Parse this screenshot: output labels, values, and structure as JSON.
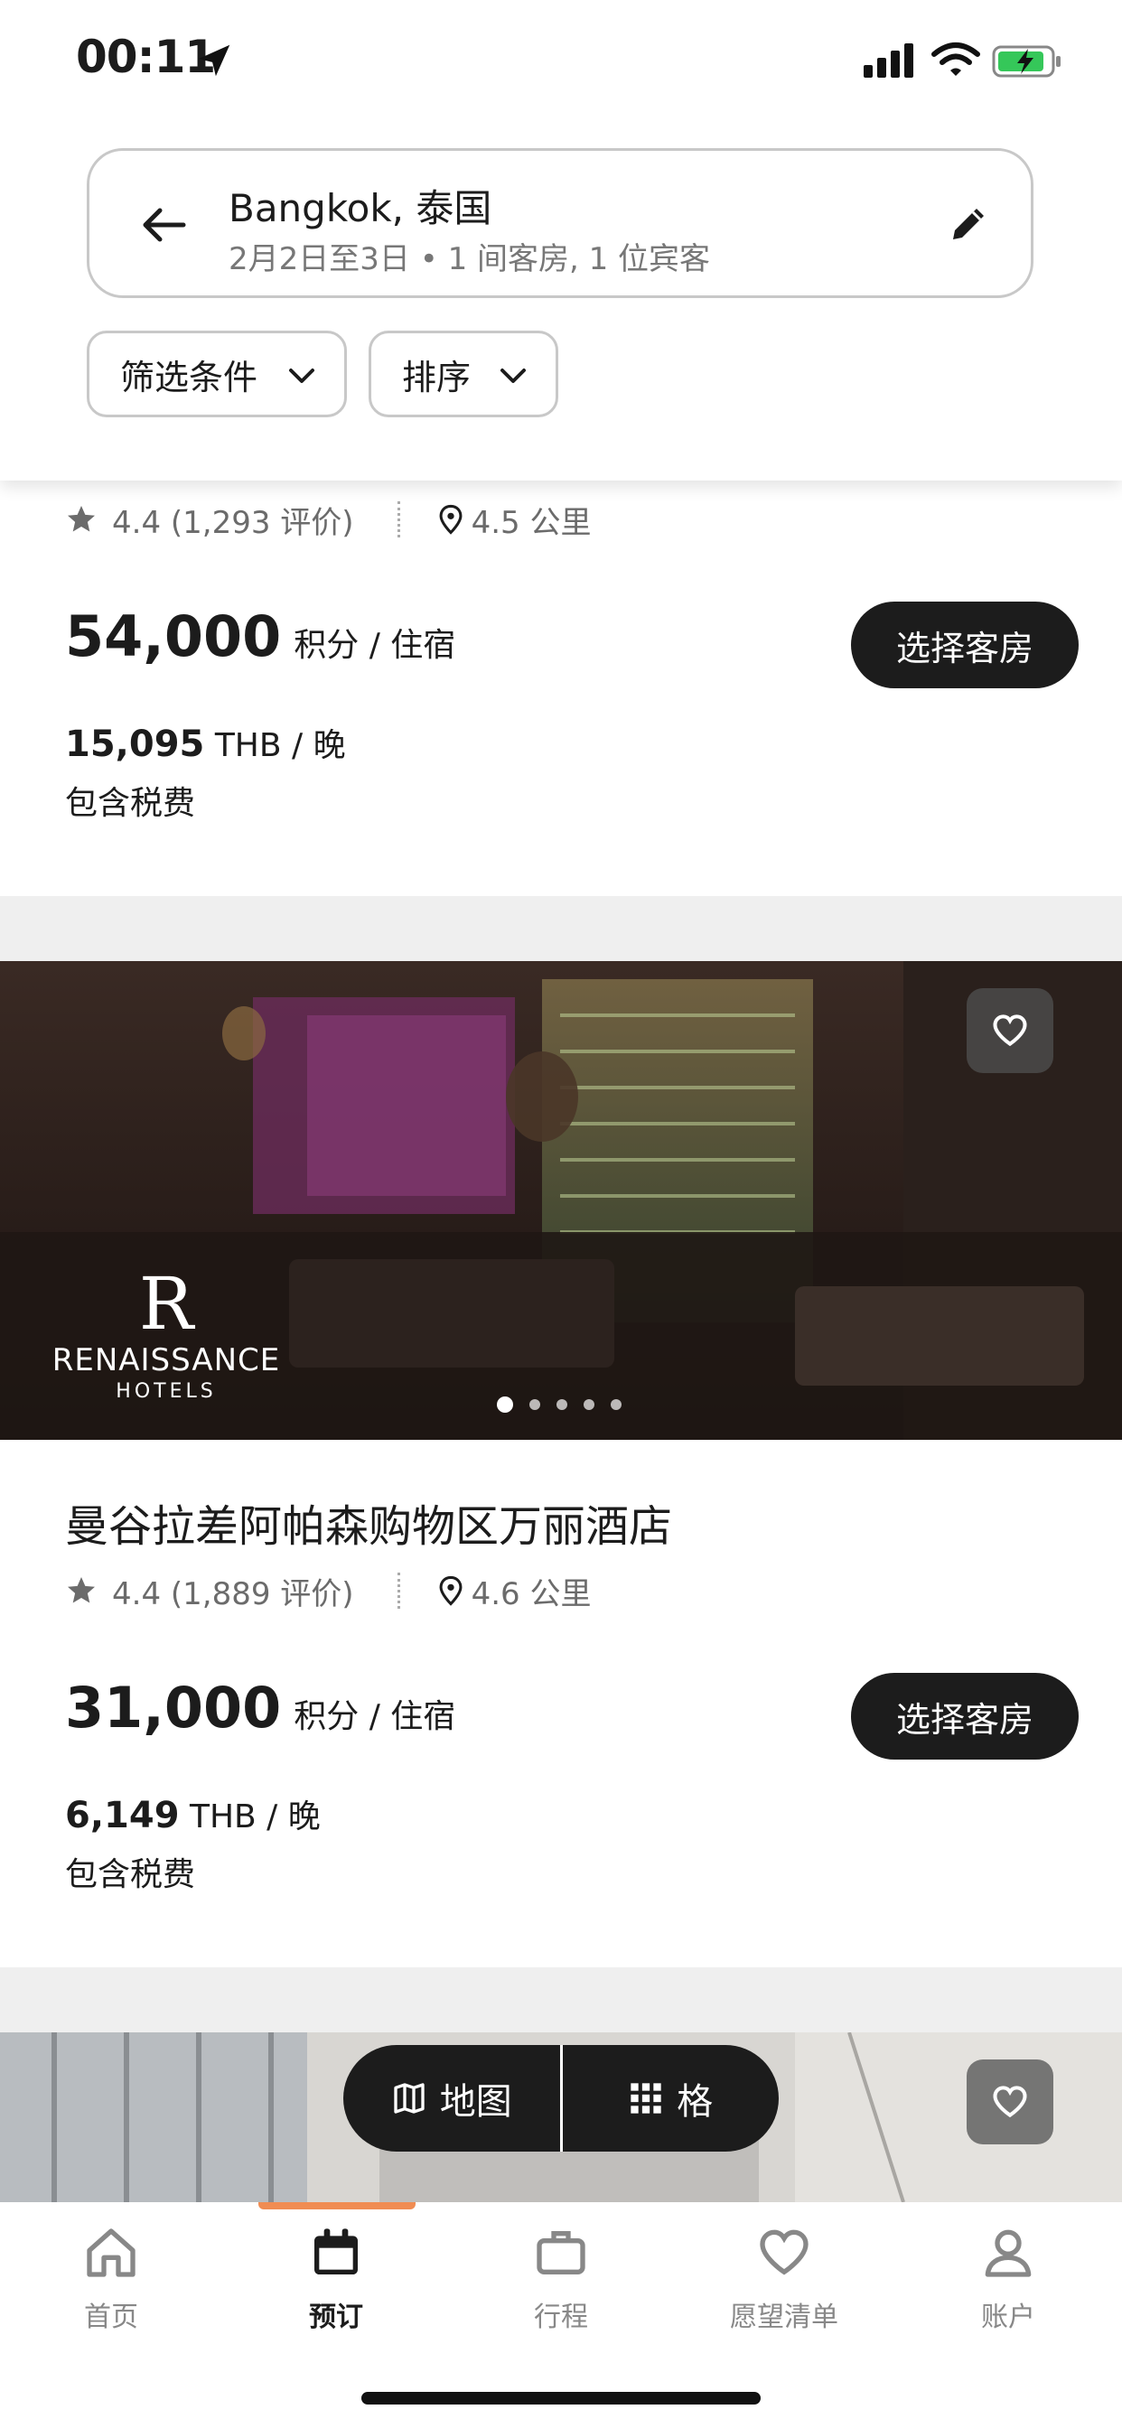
{
  "status_bar": {
    "time": "00:11"
  },
  "search": {
    "title": "Bangkok, 泰国",
    "subtitle": "2月2日至3日 • 1 间客房, 1 位宾客"
  },
  "filters": {
    "filter_label": "筛选条件",
    "sort_label": "排序"
  },
  "hotels": [
    {
      "name": "",
      "rating": "4.4 (1,293 评价)",
      "distance": "4.5 公里",
      "points": "54,000",
      "points_unit": "积分 / 住宿",
      "select_label": "选择客房",
      "rate": "15,095",
      "rate_unit": "THB / 晚",
      "tax_note": "包含税费"
    },
    {
      "name": "曼谷拉差阿帕森购物区万丽酒店",
      "brand_initial": "R",
      "brand_name": "RENAISSANCE",
      "brand_sub": "HOTELS",
      "rating": "4.4 (1,889 评价)",
      "distance": "4.6 公里",
      "points": "31,000",
      "points_unit": "积分 / 住宿",
      "select_label": "选择客房",
      "rate": "6,149",
      "rate_unit": "THB / 晚",
      "tax_note": "包含税费",
      "photo_count": 5,
      "photo_index": 1
    }
  ],
  "view_toggle": {
    "map_label": "地图",
    "grid_label": "格"
  },
  "bottom_nav": {
    "items": [
      {
        "label": "首页",
        "icon": "home-icon",
        "active": false
      },
      {
        "label": "预订",
        "icon": "calendar-icon",
        "active": true
      },
      {
        "label": "行程",
        "icon": "briefcase-icon",
        "active": false
      },
      {
        "label": "愿望清单",
        "icon": "heart-icon",
        "active": false
      },
      {
        "label": "账户",
        "icon": "person-icon",
        "active": false
      }
    ]
  },
  "colors": {
    "accent": "#f08c52",
    "button_dark": "#1c1c1c",
    "separator": "#efefef"
  }
}
